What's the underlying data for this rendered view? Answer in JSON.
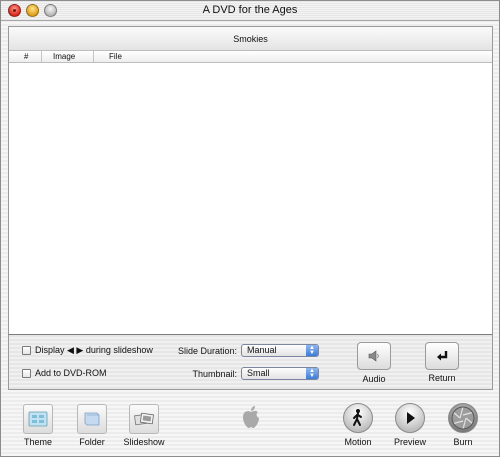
{
  "window": {
    "title": "A DVD for the Ages"
  },
  "panel": {
    "title": "Smokies",
    "columns": [
      "#",
      "Image",
      "File"
    ]
  },
  "controls": {
    "display_label": "Display ◀ ▶ during slideshow",
    "add_rom_label": "Add to DVD-ROM",
    "slide_duration_label": "Slide Duration:",
    "slide_duration_value": "Manual",
    "thumbnail_label": "Thumbnail:",
    "thumbnail_value": "Small",
    "audio_label": "Audio",
    "return_label": "Return"
  },
  "toolbar": {
    "theme": "Theme",
    "folder": "Folder",
    "slideshow": "Slideshow",
    "motion": "Motion",
    "preview": "Preview",
    "burn": "Burn"
  }
}
